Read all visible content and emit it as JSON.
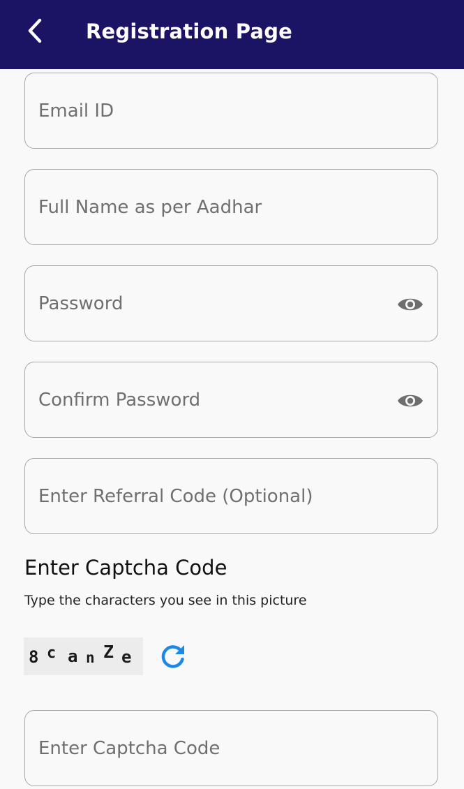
{
  "header": {
    "title": "Registration Page",
    "background": "#1b1464",
    "back_icon": "chevron-left-icon"
  },
  "form": {
    "email_placeholder": "Email ID",
    "full_name_placeholder": "Full Name as per Aadhar",
    "password_placeholder": "Password",
    "confirm_password_placeholder": "Confirm Password",
    "referral_placeholder": "Enter Referral Code (Optional)",
    "password_toggle_icon": "eye-icon"
  },
  "captcha": {
    "heading": "Enter Captcha Code",
    "subtitle": "Type the characters you see in this picture",
    "characters": [
      "8",
      "c",
      "a",
      "n",
      "Z",
      "e"
    ],
    "refresh_icon": "refresh-icon",
    "refresh_color": "#1e88e5",
    "input_placeholder": "Enter Captcha Code"
  }
}
